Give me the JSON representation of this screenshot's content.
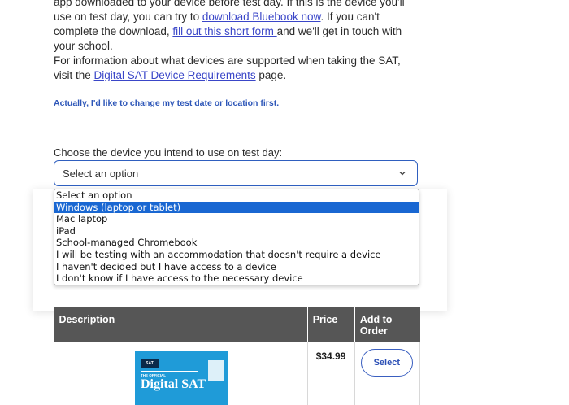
{
  "intro": {
    "part1": "app downloaded to your device before test day. If this is the device you'll use on test day, you can try to ",
    "download_link": "download Bluebook now",
    "part2": ". If you can't complete the download, ",
    "form_link": "fill out this short form ",
    "part3": "and we'll get in touch with your school."
  },
  "devices_info": {
    "text": "For information about what devices are supported when taking the SAT, visit the ",
    "link": "Digital SAT Device Requirements",
    "tail": " page."
  },
  "change_link": "Actually, I'd like to change my test date or location first.",
  "device_select": {
    "label": "Choose the device you intend to use on test day:",
    "value": "Select an option",
    "options": [
      "Select an option",
      "Windows (laptop or tablet)",
      "Mac laptop",
      "iPad",
      "School-managed Chromebook",
      "I will be testing with an accommodation that doesn't require a device",
      "I haven't decided but I have access to a device",
      "I don't know if I have access to the necessary device"
    ],
    "highlighted_index": 1
  },
  "order_table": {
    "headers": {
      "description": "Description",
      "price": "Price",
      "add_to_order": "Add to Order"
    },
    "rows": [
      {
        "price": "$34.99",
        "button": "Select",
        "book": {
          "badge": "SAT",
          "subtitle": "THE OFFICIAL",
          "title": "Digital SAT"
        }
      }
    ]
  },
  "colors": {
    "link": "#3a46c8",
    "accent": "#2f5fbf",
    "highlight": "#1967d2",
    "table_header": "#565656"
  }
}
